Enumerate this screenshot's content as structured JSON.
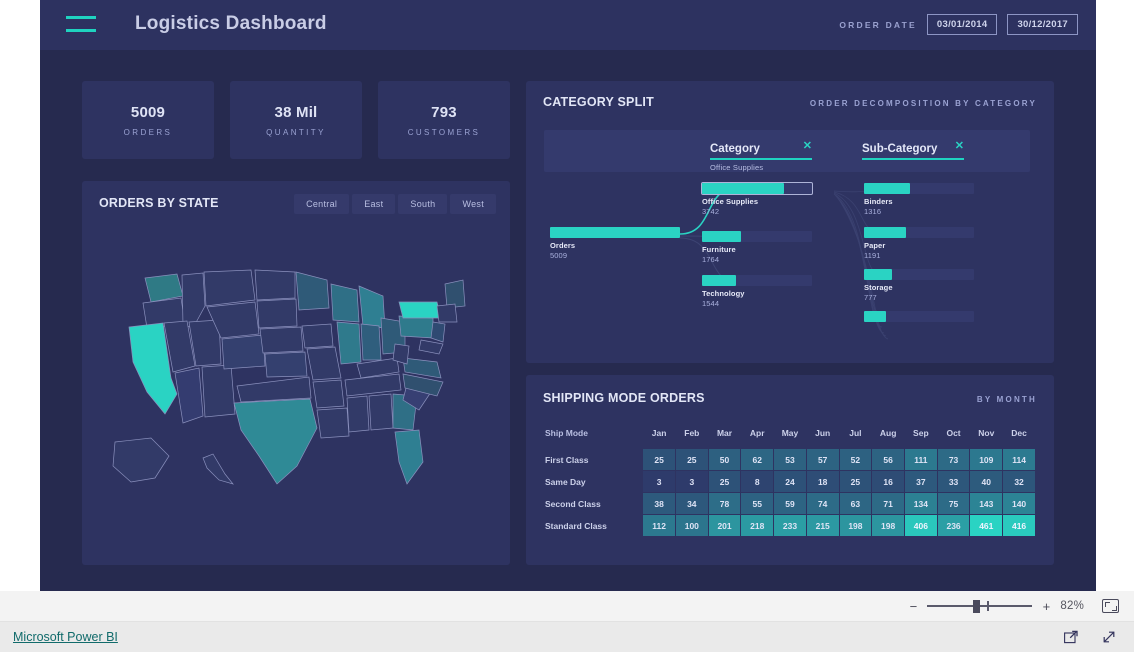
{
  "header": {
    "title": "Logistics Dashboard",
    "menu_icon": "hamburger-icon",
    "order_date_label": "ORDER DATE",
    "date_from": "03/01/2014",
    "date_to": "30/12/2017"
  },
  "kpis": [
    {
      "value": "5009",
      "label": "ORDERS"
    },
    {
      "value": "38 Mil",
      "label": "QUANTITY"
    },
    {
      "value": "793",
      "label": "CUSTOMERS"
    }
  ],
  "map_panel": {
    "title": "ORDERS BY STATE",
    "regions": [
      "Central",
      "East",
      "South",
      "West"
    ]
  },
  "category_panel": {
    "title": "CATEGORY SPLIT",
    "subtitle": "ORDER DECOMPOSITION BY CATEGORY",
    "slicers": [
      {
        "name": "Category",
        "selected": "Office Supplies",
        "clear": "✕"
      },
      {
        "name": "Sub-Category",
        "selected": "",
        "clear": "✕"
      }
    ]
  },
  "shipping_panel": {
    "title": "SHIPPING MODE ORDERS",
    "subtitle": "BY MONTH"
  },
  "zoom": {
    "minus": "−",
    "plus": "+",
    "percent": "82%"
  },
  "footer": {
    "link": "Microsoft Power BI",
    "share_icon": "share-icon",
    "fullscreen_icon": "fullscreen-icon"
  },
  "chart_data": [
    {
      "type": "bar",
      "name": "decomposition-tree",
      "title": "CATEGORY SPLIT",
      "subtitle": "ORDER DECOMPOSITION BY CATEGORY",
      "root": {
        "label": "Orders",
        "value": 5009
      },
      "levels": [
        "Category",
        "Sub-Category"
      ],
      "categories": [
        {
          "label": "Office Supplies",
          "value": 3742,
          "selected": true
        },
        {
          "label": "Furniture",
          "value": 1764,
          "selected": false
        },
        {
          "label": "Technology",
          "value": 1544,
          "selected": false
        }
      ],
      "sub_categories": [
        {
          "label": "Binders",
          "value": 1316
        },
        {
          "label": "Paper",
          "value": 1191
        },
        {
          "label": "Storage",
          "value": 777
        },
        {
          "label": "",
          "value": 600
        }
      ],
      "max_category": 5009,
      "max_sub_category": 2200
    },
    {
      "type": "heatmap",
      "name": "shipping-mode-orders",
      "title": "SHIPPING MODE ORDERS",
      "subtitle": "BY MONTH",
      "row_header": "Ship Mode",
      "categories": [
        "Jan",
        "Feb",
        "Mar",
        "Apr",
        "May",
        "Jun",
        "Jul",
        "Aug",
        "Sep",
        "Oct",
        "Nov",
        "Dec"
      ],
      "series": [
        {
          "name": "First Class",
          "values": [
            25,
            25,
            50,
            62,
            53,
            57,
            52,
            56,
            111,
            73,
            109,
            114
          ]
        },
        {
          "name": "Same Day",
          "values": [
            3,
            3,
            25,
            8,
            24,
            18,
            25,
            16,
            37,
            33,
            40,
            32
          ]
        },
        {
          "name": "Second Class",
          "values": [
            38,
            34,
            78,
            55,
            59,
            74,
            63,
            71,
            134,
            75,
            143,
            140
          ]
        },
        {
          "name": "Standard Class",
          "values": [
            112,
            100,
            201,
            218,
            233,
            215,
            198,
            198,
            406,
            236,
            461,
            416
          ]
        }
      ],
      "scale_min": 3,
      "scale_max": 461,
      "low_color": "#2e3b6b",
      "high_color": "#2ad3c3"
    },
    {
      "type": "map",
      "name": "orders-by-state-map",
      "title": "ORDERS BY STATE",
      "region_filters": [
        "Central",
        "East",
        "South",
        "West"
      ],
      "highlighted_states": [
        {
          "state": "California",
          "intensity": "highest"
        },
        {
          "state": "Texas",
          "intensity": "high"
        },
        {
          "state": "New York",
          "intensity": "high"
        },
        {
          "state": "Washington",
          "intensity": "medium"
        },
        {
          "state": "Pennsylvania",
          "intensity": "medium"
        },
        {
          "state": "Illinois",
          "intensity": "medium"
        },
        {
          "state": "Florida",
          "intensity": "medium"
        },
        {
          "state": "Ohio",
          "intensity": "medium-low"
        },
        {
          "state": "Michigan",
          "intensity": "medium-low"
        }
      ],
      "low_color": "#323a68",
      "high_color": "#2ad3c3"
    }
  ],
  "colors": {
    "canvas": "#262a4f",
    "panel": "#2e3361",
    "topbar": "#2d3260",
    "accent": "#2ad3c3",
    "text": "#e2e6f6",
    "muted": "#9aa2d2"
  }
}
